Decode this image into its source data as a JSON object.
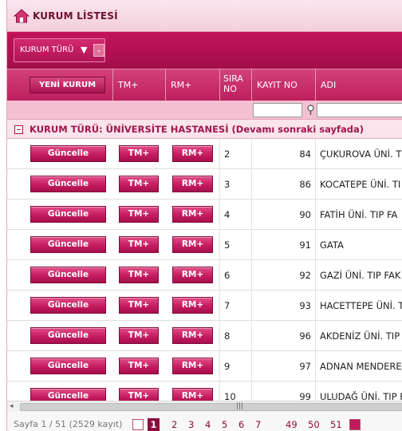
{
  "title": "KURUM LİSTESİ",
  "toolbar": {
    "type_button_label": "KURUM TÜRÜ"
  },
  "header": {
    "new_button": "YENİ KURUM",
    "col_tm": "TM+",
    "col_rm": "RM+",
    "col_sira": "SIRA NO",
    "col_kayit": "KAYIT NO",
    "col_adi": "ADI"
  },
  "group": {
    "label": "KURUM TÜRÜ: ÜNİVERSİTE HASTANESİ",
    "note": "(Devamı sonraki sayfada)"
  },
  "row_buttons": {
    "update": "Güncelle",
    "tm": "TM+",
    "rm": "RM+"
  },
  "rows": [
    {
      "sira": "2",
      "kayit": "84",
      "adi": "ÇUKUROVA ÜNİ. TI"
    },
    {
      "sira": "3",
      "kayit": "86",
      "adi": "KOCATEPE ÜNİ. TI"
    },
    {
      "sira": "4",
      "kayit": "90",
      "adi": "FATİH ÜNİ. TIP FA"
    },
    {
      "sira": "5",
      "kayit": "91",
      "adi": "GATA"
    },
    {
      "sira": "6",
      "kayit": "92",
      "adi": "GAZİ ÜNİ. TIP FAK"
    },
    {
      "sira": "7",
      "kayit": "93",
      "adi": "HACETTEPE ÜNİ. T"
    },
    {
      "sira": "8",
      "kayit": "96",
      "adi": "AKDENİZ ÜNİ. TIP"
    },
    {
      "sira": "9",
      "kayit": "97",
      "adi": "ADNAN MENDERES"
    },
    {
      "sira": "10",
      "kayit": "99",
      "adi": "ULUDAĞ ÜNİ. TIP F"
    }
  ],
  "pager": {
    "info": "Sayfa 1 / 51 (2529 kayıt)",
    "current": "1",
    "pages": [
      "2",
      "3",
      "4",
      "5",
      "6",
      "7",
      "49",
      "50",
      "51"
    ]
  },
  "colors": {
    "accent": "#c2195c",
    "header": "#bd1f5d",
    "group_text": "#a0154c"
  }
}
